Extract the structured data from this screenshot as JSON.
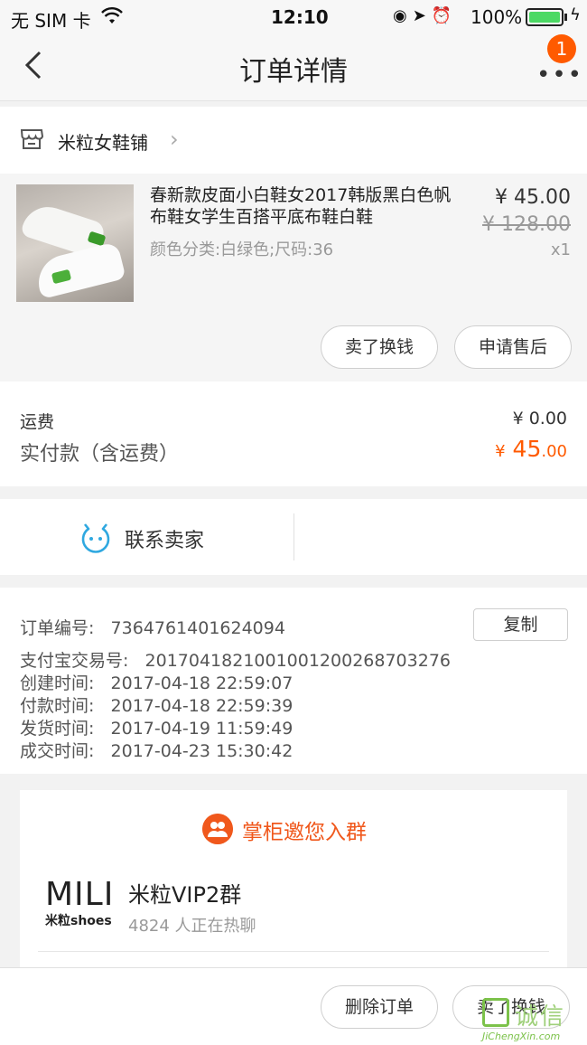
{
  "status_bar": {
    "carrier": "无 SIM 卡",
    "time": "12:10",
    "battery_percent": "100%",
    "battery_level": 1.0
  },
  "nav": {
    "title": "订单详情",
    "more_badge": "1",
    "more_glyph": "•••"
  },
  "shop": {
    "name": "米粒女鞋铺"
  },
  "product": {
    "title": "春新款皮面小白鞋女2017韩版黑白色帆布鞋女学生百搭平底布鞋白鞋",
    "spec": "颜色分类:白绿色;尺码:36",
    "price": "¥ 45.00",
    "original_price": "¥ 128.00",
    "quantity": "x1",
    "buttons": {
      "sell": "卖了换钱",
      "after_sales": "申请售后"
    }
  },
  "fees": {
    "shipping_label": "运费",
    "shipping_value": "¥ 0.00",
    "paid_label": "实付款（含运费）",
    "paid_currency": "¥",
    "paid_integer": "45",
    "paid_decimal": ".00"
  },
  "contact": {
    "label": "联系卖家"
  },
  "order_info": {
    "copy_button": "复制",
    "lines": [
      "订单编号:   7364761401624094",
      "支付宝交易号:   2017041821001001200268703276",
      "创建时间:   2017-04-18 22:59:07",
      "付款时间:   2017-04-18 22:59:39",
      "发货时间:   2017-04-19 11:59:49",
      "成交时间:   2017-04-23 15:30:42"
    ]
  },
  "group": {
    "title": "掌柜邀您入群",
    "logo_text": "MILI",
    "logo_sub": "米粒shoes",
    "name": "米粒VIP2群",
    "subtitle": "4824 人正在热聊"
  },
  "footer": {
    "delete": "删除订单",
    "sell": "卖了换钱"
  },
  "watermark": {
    "text": "诚信",
    "url": "JiChengXin.com"
  },
  "colors": {
    "accent": "#ff5a00",
    "group_orange": "#f0581c",
    "chat_blue": "#2fa8e0",
    "battery_green": "#4cd964"
  }
}
